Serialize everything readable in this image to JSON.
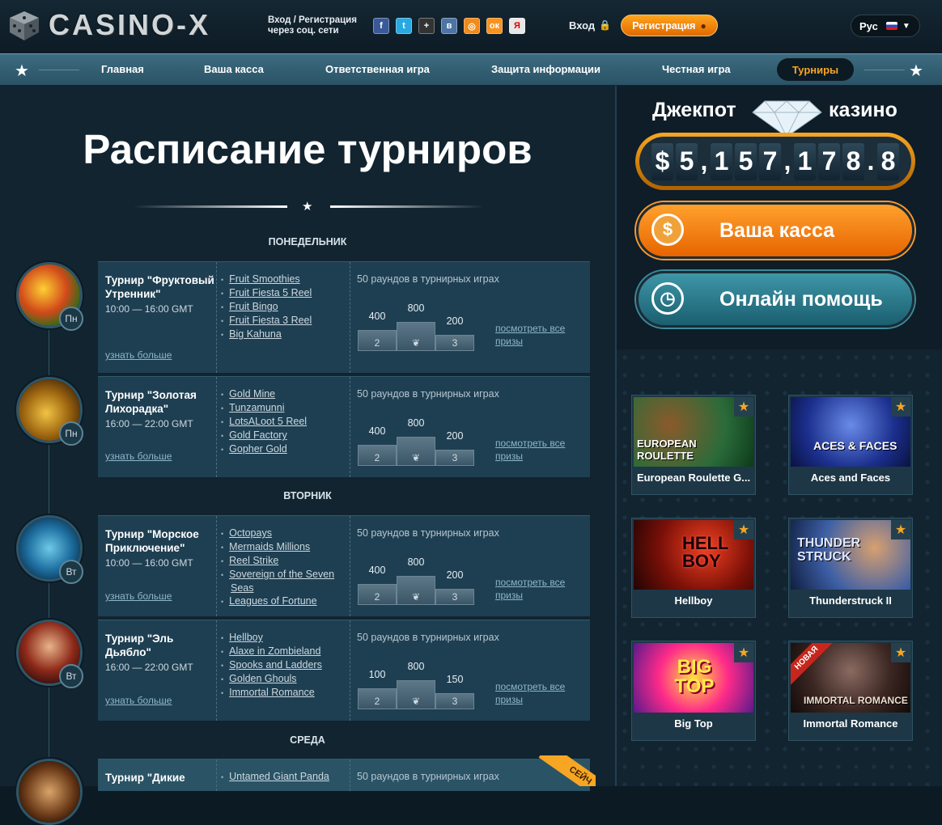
{
  "header": {
    "logo_text": "CASINO-X",
    "social_label_line1": "Вход / Регистрация",
    "social_label_line2": "через соц. сети",
    "social_icons": [
      "f",
      "t",
      "+",
      "в",
      "◎",
      "ок",
      "Я"
    ],
    "login_label": "Вход",
    "register_label": "Регистрация",
    "language": "Рус"
  },
  "nav": {
    "items": [
      "Главная",
      "Ваша касса",
      "Ответственная игра",
      "Защита информации",
      "Честная игра",
      "Турниры"
    ],
    "active": "Турниры"
  },
  "main": {
    "title": "Расписание турниров",
    "days": [
      "ПОНЕДЕЛЬНИК",
      "ВТОРНИК",
      "СРЕДА"
    ],
    "tournaments": [
      {
        "name": "Турнир \"Фруктовый Утренник\"",
        "time": "10:00 — 16:00 GMT",
        "day_badge": "Пн",
        "more": "узнать больше",
        "games": [
          "Fruit Smoothies",
          "Fruit Fiesta 5 Reel",
          "Fruit Bingo",
          "Fruit Fiesta 3 Reel",
          "Big Kahuna"
        ],
        "rounds": "50 раундов в турнирных играх",
        "prize1": "800",
        "prize2": "400",
        "prize3": "200",
        "all_prizes_1": "посмотреть все",
        "all_prizes_2": "призы"
      },
      {
        "name": "Турнир \"Золотая Лихорадка\"",
        "time": "16:00 — 22:00 GMT",
        "day_badge": "Пн",
        "more": "узнать больше",
        "games": [
          "Gold Mine",
          "Tunzamunni",
          "LotsALoot 5 Reel",
          "Gold Factory",
          "Gopher Gold"
        ],
        "rounds": "50 раундов в турнирных играх",
        "prize1": "800",
        "prize2": "400",
        "prize3": "200",
        "all_prizes_1": "посмотреть все",
        "all_prizes_2": "призы"
      },
      {
        "name": "Турнир \"Морское Приключение\"",
        "time": "10:00 — 16:00 GMT",
        "day_badge": "Вт",
        "more": "узнать больше",
        "games": [
          "Octopays",
          "Mermaids Millions",
          "Reel Strike",
          "Sovereign of the Seven Seas",
          "Leagues of Fortune"
        ],
        "rounds": "50 раундов в турнирных играх",
        "prize1": "800",
        "prize2": "400",
        "prize3": "200",
        "all_prizes_1": "посмотреть все",
        "all_prizes_2": "призы"
      },
      {
        "name": "Турнир \"Эль Дьябло\"",
        "time": "16:00 — 22:00 GMT",
        "day_badge": "Вт",
        "more": "узнать больше",
        "games": [
          "Hellboy",
          "Alaxe in Zombieland",
          "Spooks and Ladders",
          "Golden Ghouls",
          "Immortal Romance"
        ],
        "rounds": "50 раундов в турнирных играх",
        "prize1": "800",
        "prize2": "100",
        "prize3": "150",
        "all_prizes_1": "посмотреть все",
        "all_prizes_2": "призы"
      },
      {
        "name": "Турнир \"Дикие",
        "games": [
          "Untamed Giant Panda"
        ],
        "rounds": "50 раундов в турнирных играх",
        "ribbon": "СЕЙЧ"
      }
    ],
    "podium_places": [
      "2",
      "3"
    ]
  },
  "sidebar": {
    "jackpot_label_left": "Джекпот",
    "jackpot_label_right": "казино",
    "jackpot_digits": [
      "$",
      "5",
      ",",
      "1",
      "5",
      "7",
      ",",
      "1",
      "7",
      "8",
      ".",
      "8"
    ],
    "cash_button": "Ваша касса",
    "help_button": "Онлайн помощь",
    "games": [
      "European Roulette G...",
      "Aces and Faces",
      "Hellboy",
      "Thunderstruck II",
      "Big Top",
      "Immortal Romance"
    ],
    "new_ribbon": "НОВАЯ",
    "thumb_texts": [
      "EUROPEAN ROULETTE",
      "ACES & FACES",
      "HELL BOY",
      "THUNDER STRUCK",
      "BIG TOP",
      "IMMORTAL ROMANCE"
    ]
  }
}
